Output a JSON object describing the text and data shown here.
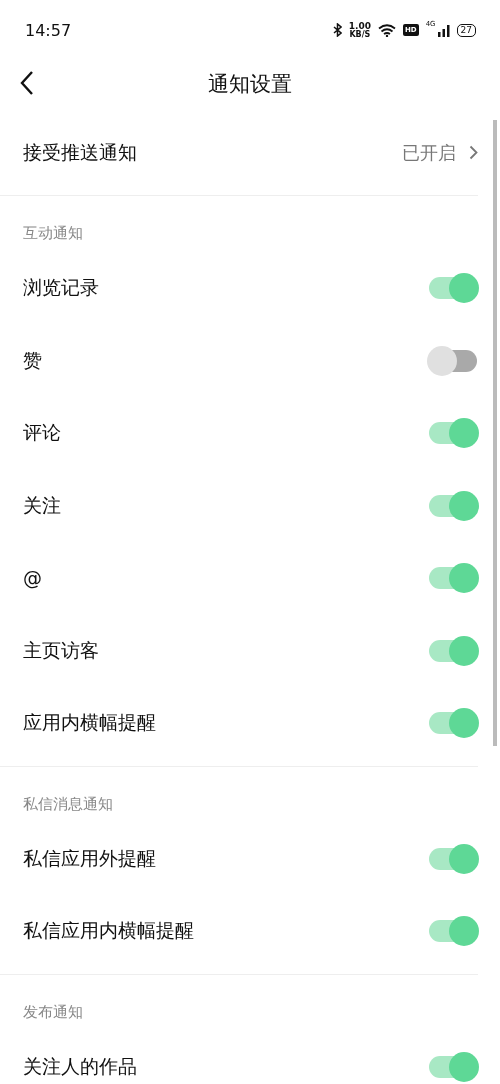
{
  "status_bar": {
    "time": "14:57",
    "speed_value": "1.00",
    "speed_unit": "KB/S",
    "hd": "HD",
    "network": "4G",
    "battery": "27"
  },
  "nav": {
    "title": "通知设置"
  },
  "push": {
    "label": "接受推送通知",
    "value": "已开启"
  },
  "sections": [
    {
      "title": "互动通知",
      "items": [
        {
          "label": "浏览记录",
          "on": true
        },
        {
          "label": "赞",
          "on": false
        },
        {
          "label": "评论",
          "on": true
        },
        {
          "label": "关注",
          "on": true
        },
        {
          "label": "@",
          "on": true
        },
        {
          "label": "主页访客",
          "on": true
        },
        {
          "label": "应用内横幅提醒",
          "on": true
        }
      ]
    },
    {
      "title": "私信消息通知",
      "items": [
        {
          "label": "私信应用外提醒",
          "on": true
        },
        {
          "label": "私信应用内横幅提醒",
          "on": true
        }
      ]
    },
    {
      "title": "发布通知",
      "items": [
        {
          "label": "关注人的作品",
          "on": true
        }
      ]
    }
  ]
}
